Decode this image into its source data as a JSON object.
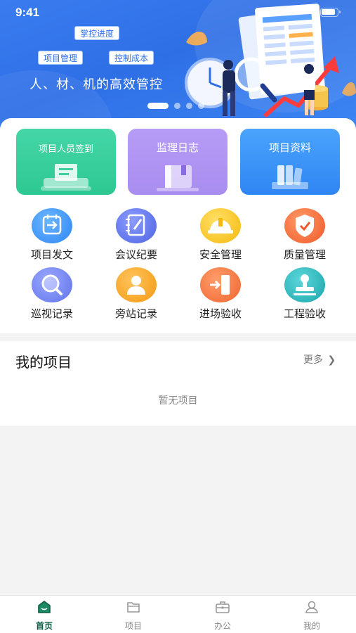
{
  "status_bar": {
    "time": "9:41"
  },
  "banner": {
    "tags": [
      "掌控进度",
      "项目管理",
      "控制成本"
    ],
    "slogan": "人、材、机的高效管控"
  },
  "quick_cards": [
    {
      "label": "项目人员签到",
      "color": "#2dc892"
    },
    {
      "label": "监理日志",
      "color": "#a98cf0"
    },
    {
      "label": "项目资料",
      "color": "#2f86f4"
    }
  ],
  "grid_items": [
    {
      "label": "项目发文",
      "icon": "document-arrow-icon",
      "color": "#3a8cf5"
    },
    {
      "label": "会议纪要",
      "icon": "notebook-pen-icon",
      "color": "#5b6fe6"
    },
    {
      "label": "安全管理",
      "icon": "hard-hat-icon",
      "color": "#f5c21b"
    },
    {
      "label": "质量管理",
      "icon": "shield-check-icon",
      "color": "#f26a3c"
    },
    {
      "label": "巡视记录",
      "icon": "magnifier-icon",
      "color": "#6c7ef0"
    },
    {
      "label": "旁站记录",
      "icon": "person-icon",
      "color": "#f6a623"
    },
    {
      "label": "进场验收",
      "icon": "enter-door-icon",
      "color": "#f4733a"
    },
    {
      "label": "工程验收",
      "icon": "stamp-icon",
      "color": "#26b3b8"
    }
  ],
  "my_projects": {
    "title": "我的项目",
    "more": "更多",
    "empty_text": "暂无项目"
  },
  "tabbar": [
    {
      "label": "首页",
      "icon": "home-icon",
      "active": true
    },
    {
      "label": "项目",
      "icon": "folder-icon",
      "active": false
    },
    {
      "label": "办公",
      "icon": "briefcase-icon",
      "active": false
    },
    {
      "label": "我的",
      "icon": "user-icon",
      "active": false
    }
  ],
  "colors": {
    "brand_blue": "#2f6fe6",
    "tab_active": "#0f5d46"
  }
}
